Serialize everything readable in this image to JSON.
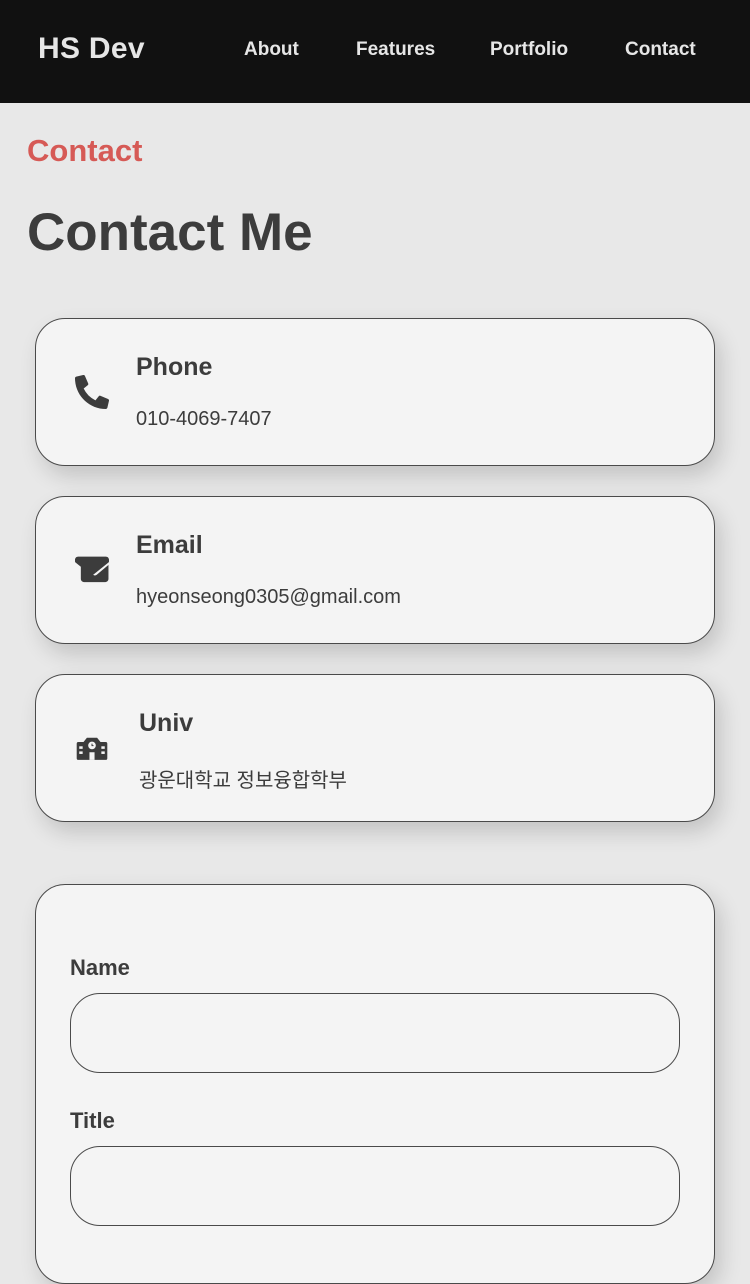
{
  "header": {
    "brand": "HS Dev",
    "nav": [
      "About",
      "Features",
      "Portfolio",
      "Contact"
    ]
  },
  "section": {
    "label": "Contact",
    "title": "Contact Me"
  },
  "contact_cards": [
    {
      "title": "Phone",
      "value": "010-4069-7407",
      "icon": "phone-icon"
    },
    {
      "title": "Email",
      "value": "hyeonseong0305@gmail.com",
      "icon": "envelope-icon"
    },
    {
      "title": "Univ",
      "value": "광운대학교 정보융합학부",
      "icon": "school-icon"
    }
  ],
  "form": {
    "name_label": "Name",
    "name_value": "",
    "title_label": "Title",
    "title_value": ""
  },
  "colors": {
    "navbar_bg": "#111111",
    "page_bg": "#e8e8e8",
    "accent": "#d65a56",
    "card_bg": "#f4f4f4",
    "text": "#3c3c3c"
  }
}
